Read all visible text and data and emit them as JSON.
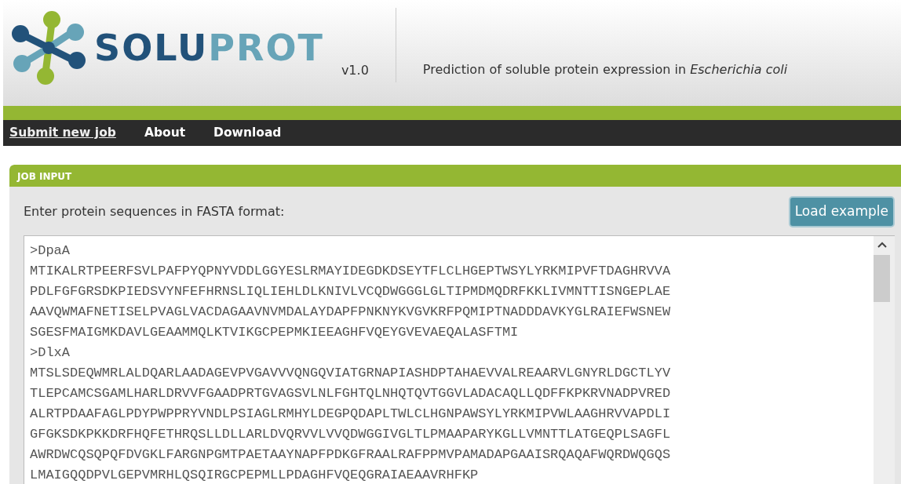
{
  "header": {
    "logo": [
      {
        "text": "SOLU",
        "kind": "dark"
      },
      {
        "text": "PROT",
        "kind": "light"
      }
    ],
    "version": "v1.0",
    "tagline": "Prediction of soluble protein expression in *Escherichia coli*"
  },
  "nav": [
    {
      "label": "Submit new job",
      "selected": true
    },
    {
      "label": "About",
      "selected": false
    },
    {
      "label": "Download",
      "selected": false
    }
  ],
  "panel": {
    "title": "JOB INPUT",
    "prompt": "Enter protein sequences in FASTA format:",
    "button": "Load example",
    "sequence_lines": [
      ">DpaA",
      "MTIKALRTPEERFSVLPAFPYQPNYVDDLGGYESLRMAYIDEGDKDSEYTFLCLHGEPTWSYLYRKMIPVFTDAGHRVVA",
      "PDLFGFGRSDKPIEDSVYNFEFHRNSLIQLIEHLDLKNIVLVCQDWGGGLGLTIPMDMQDRFKKLIVMNTTISNGEPLAE",
      "AAVQWMAFNETISELPVAGLVACDAGAAVNVMDALAYDAPFPNKNYKVGVKRFPQMIPTNADDDAVKYGLRAIEFWSNEW",
      "SGESFMAIGMKDAVLGEAAMMQLKTVIKGCPEPMKIEEAGHFVQEYGVEVAEQALASFTMI",
      ">DlxA",
      "MTSLSDEQWMRLALDQARLAADAGEVPVGAVVVQNGQVIATGRNAPIASHDPTAHAEVVALREAARVLGNYRLDGCTLYV",
      "TLEPCAMCSGAMLHARLDRVVFGAADPRTGVAGSVLNLFGHTQLNHQTQVTGGVLADACAQLLQDFFKPKRVNADPVRED",
      "ALRTPDAAFAGLPDYPWPPRYVNDLPSIAGLRMHYLDEGPQDAPLTWLCLHGNPAWSYLYRKMIPVWLAAGHRVVAPDLI",
      "GFGKSDKPKKDRFHQFETHRQSLLDLLARLDVQRVVLVVQDWGGIVGLTLPMAAPARYKGLLVMNTTLATGEQPLSAGFL",
      "AWRDWCQSQPQFDVGKLFARGNPGMTPAETAAYNAPFPDKGFRAALRAFPPMVPAMADAPGAAISRQAQAFWQRDWQGQS",
      "LMAIGQQDPVLGEPVMRHLQSQIRGCPEPMLLPDAGHFVQEQGRAIAEAAVRHFKP"
    ]
  }
}
